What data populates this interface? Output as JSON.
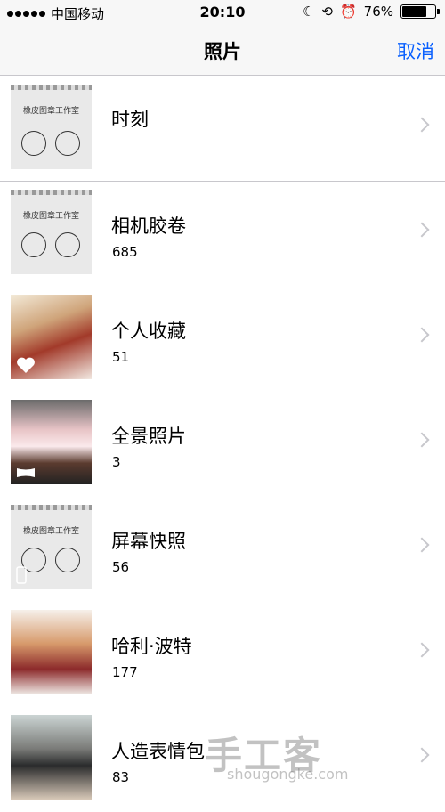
{
  "status": {
    "carrier": "中国移动",
    "time": "20:10",
    "battery": "76%",
    "battery_level": 0.76
  },
  "nav": {
    "title": "照片",
    "cancel": "取消"
  },
  "albums": [
    {
      "title": "时刻",
      "count": ""
    },
    {
      "title": "相机胶卷",
      "count": "685"
    },
    {
      "title": "个人收藏",
      "count": "51"
    },
    {
      "title": "全景照片",
      "count": "3"
    },
    {
      "title": "屏幕快照",
      "count": "56"
    },
    {
      "title": "哈利·波特",
      "count": "177"
    },
    {
      "title": "人造表情包",
      "count": "83"
    }
  ],
  "thumb_text": "橡皮图章工作室",
  "watermark": {
    "main": "手工客",
    "sub": "shougongke.com"
  },
  "colors": {
    "accent": "#0a60fe",
    "separator": "#c8c7cc",
    "chevron": "#c7c7cc"
  }
}
